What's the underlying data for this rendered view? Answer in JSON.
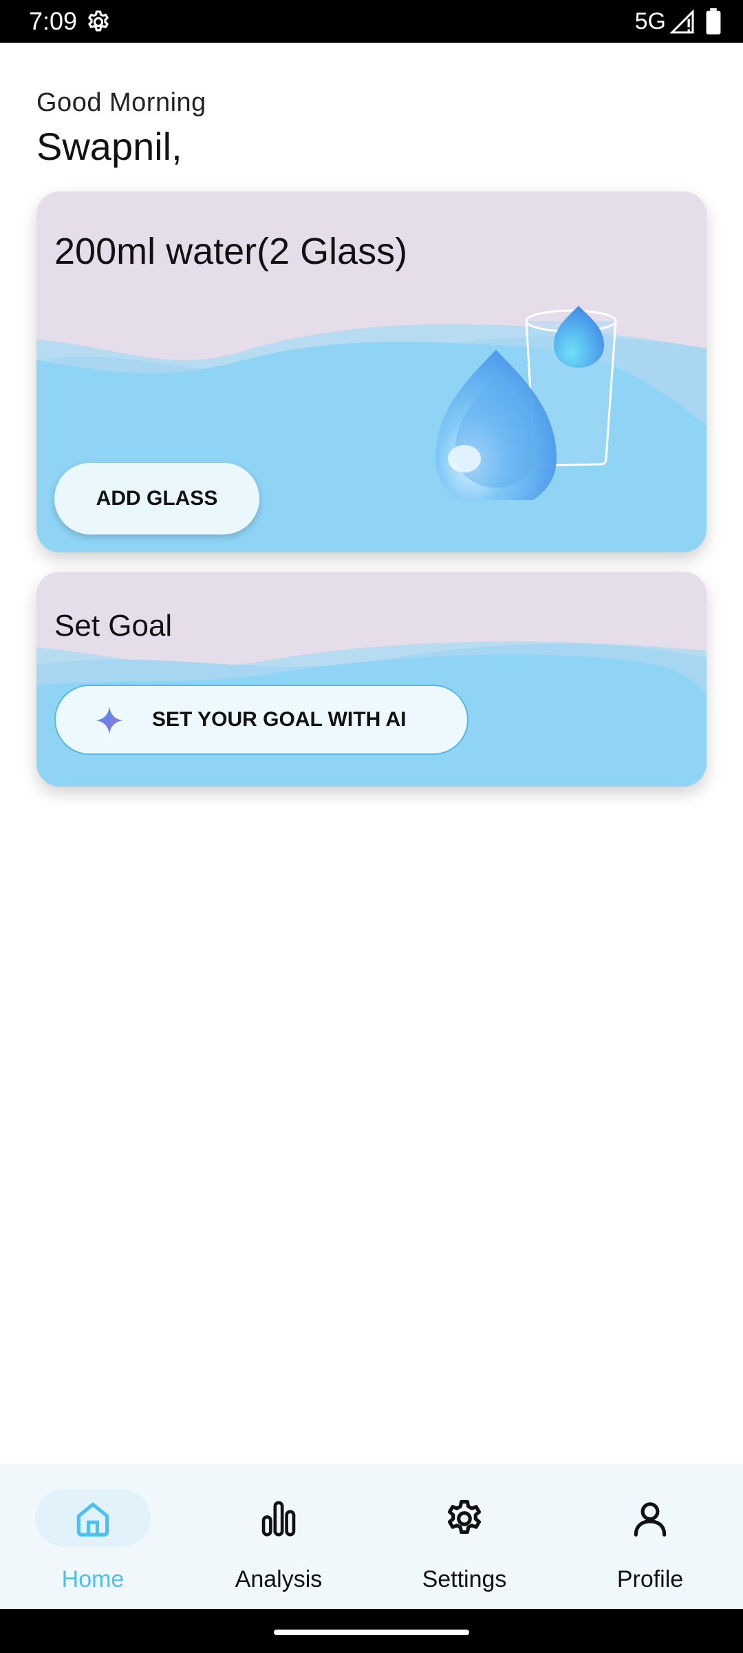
{
  "status_bar": {
    "time": "7:09",
    "network": "5G",
    "icons": [
      "settings-icon",
      "signal-icon",
      "battery-icon"
    ]
  },
  "header": {
    "greeting": "Good Morning",
    "username": "Swapnil,"
  },
  "water_card": {
    "title": "200ml water(2 Glass)",
    "add_button_label": "ADD GLASS",
    "illustration": "water-glass-drops"
  },
  "goal_card": {
    "title": "Set Goal",
    "ai_button_label": "SET YOUR GOAL WITH AI",
    "ai_icon": "sparkle-icon"
  },
  "bottom_nav": {
    "items": [
      {
        "label": "Home",
        "icon": "home-icon",
        "active": true
      },
      {
        "label": "Analysis",
        "icon": "bar-chart-icon",
        "active": false
      },
      {
        "label": "Settings",
        "icon": "gear-icon",
        "active": false
      },
      {
        "label": "Profile",
        "icon": "person-icon",
        "active": false
      }
    ]
  },
  "colors": {
    "accent": "#4fc0ee",
    "card_background": "#e5dde9",
    "water": "#8fd3f5",
    "nav_background": "#f1f8fc"
  }
}
